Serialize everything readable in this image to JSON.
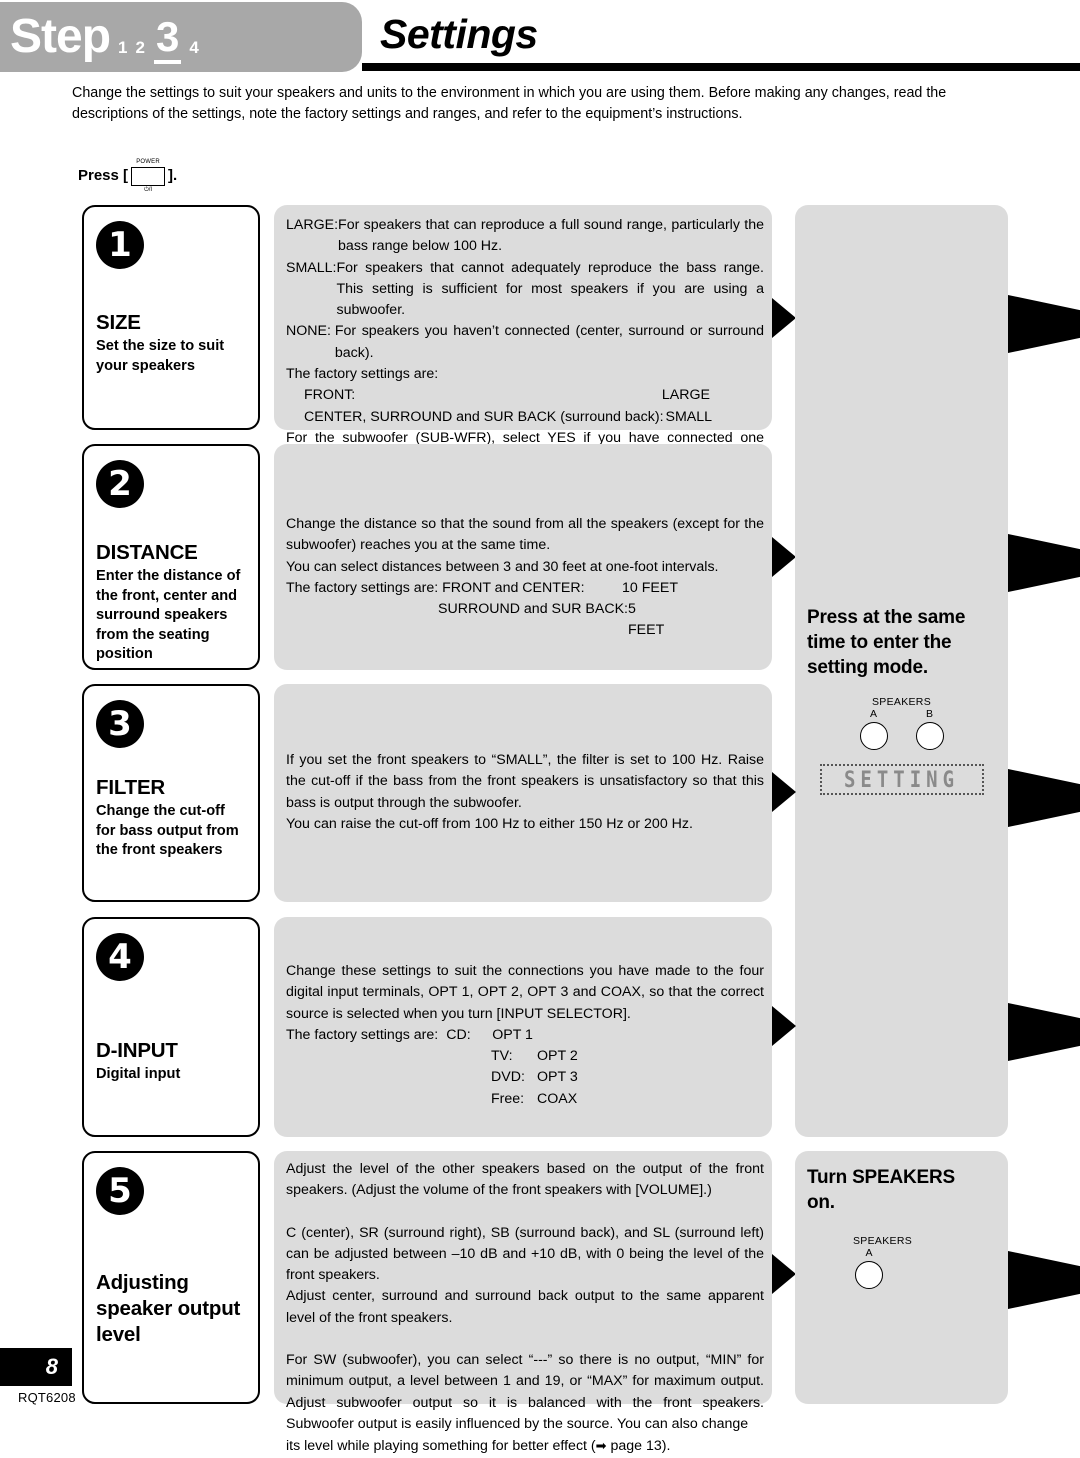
{
  "header": {
    "step_word": "Step",
    "steps": [
      "1",
      "2",
      "3",
      "4"
    ],
    "current_step": "3",
    "title": "Settings"
  },
  "intro": {
    "line1": "Change the settings to suit your speakers and units to the environment in which you are using them. Before making any changes, read the",
    "line2": "descriptions of the settings, note the factory settings and ranges, and refer to the equipment’s instructions."
  },
  "press_instruction": {
    "label": "Press [",
    "close": "].",
    "button_caption": "POWER",
    "button_symbol": "⏻/I"
  },
  "sections": [
    {
      "badge": "❶",
      "badge_num": "1",
      "title": "SIZE",
      "subtitle": "Set the size to suit\nyour speakers",
      "body": {
        "defs": [
          {
            "key": "LARGE:",
            "value": "For speakers that can reproduce a full sound range, particularly the bass range below 100 Hz."
          },
          {
            "key": "SMALL:",
            "value": "For speakers that cannot adequately reproduce the bass range. This setting is sufficient for most speakers if you are using a subwoofer."
          },
          {
            "key": "NONE: ",
            "value": "For speakers you haven’t connected (center, surround or surround back)."
          }
        ],
        "factory_label": "The factory settings are:",
        "factory_rows": [
          {
            "k": "FRONT:",
            "v": "LARGE"
          },
          {
            "k": "CENTER, SURROUND and SUR BACK (surround back):",
            "v": "SMALL"
          }
        ],
        "tail": "For the subwoofer (SUB-WFR), select YES if you have connected one (factory setting), or NO if you have not."
      }
    },
    {
      "badge": "❷",
      "badge_num": "2",
      "title": "DISTANCE",
      "subtitle": "Enter the distance of\nthe front, center and\nsurround speakers\nfrom the seating\nposition",
      "body": {
        "para1": "Change the distance so that the sound from all the speakers (except for the subwoofer) reaches you at the same time.",
        "para2": "You can select distances between 3 and 30 feet at one-foot intervals.",
        "factory_prefix": "The factory settings are: FRONT and CENTER:",
        "factory_value1": "10 FEET",
        "factory_row2_key": "SURROUND and SUR BACK:",
        "factory_row2_value": "5 FEET"
      }
    },
    {
      "badge": "❸",
      "badge_num": "3",
      "title": "FILTER",
      "subtitle": "Change the cut-off\nfor bass output from\nthe front speakers",
      "body": {
        "para1": "If you set the front speakers to “SMALL”, the filter is set to 100 Hz. Raise the cut-off if the bass from the front speakers is unsatisfactory so that this bass is output through the subwoofer.",
        "para2": "You can raise the cut-off from 100 Hz to either 150 Hz or 200 Hz."
      }
    },
    {
      "badge": "❹",
      "badge_num": "4",
      "title": "D-INPUT",
      "subtitle": "Digital input",
      "body": {
        "para1": "Change these settings to suit the connections you have made to the four digital input terminals, OPT 1, OPT 2, OPT 3 and COAX, so that the correct source is selected when you turn [INPUT SELECTOR].",
        "factory_prefix": "The factory settings are:",
        "factory_rows": [
          {
            "k": "CD:",
            "v": "OPT 1"
          },
          {
            "k": "TV:",
            "v": "OPT 2"
          },
          {
            "k": "DVD:",
            "v": "OPT 3"
          },
          {
            "k": "Free:",
            "v": "COAX"
          }
        ]
      }
    },
    {
      "badge": "❺",
      "badge_num": "5",
      "title": "Adjusting\nspeaker output\nlevel",
      "subtitle": "",
      "body": {
        "para1": "Adjust the level of the other speakers based on the output of the front speakers. (Adjust the volume of the front speakers with [VOLUME].)",
        "para2": "C (center), SR (surround right), SB (surround back), and SL (surround left) can be adjusted between –10 dB and +10 dB, with 0 being the level of the front speakers.",
        "para3": "Adjust center, surround and surround back output to the same apparent level of the front speakers.",
        "para4": "For SW (subwoofer), you can select “---” so there is no output, “MIN” for minimum output, a level between 1 and 19, or “MAX” for maximum output. Adjust subwoofer output so it is balanced with the front speakers. Subwoofer output is easily influenced by the source. You can also change",
        "para5_pre": "its level while playing something for better effect (",
        "para5_arrow": "➡",
        "para5_post": " page 13)."
      }
    }
  ],
  "right_top": {
    "heading": "Press at the same\ntime to enter the\nsetting mode.",
    "speakers_caption": "SPEAKERS",
    "knob_a": "A",
    "knob_b": "B",
    "display_text": "SETTING"
  },
  "right_bottom": {
    "heading": "Turn SPEAKERS\non.",
    "speakers_caption": "SPEAKERS",
    "knob_a": "A"
  },
  "footer": {
    "page_number": "8",
    "doc_code": "RQT6208"
  },
  "colors": {
    "banner_gray": "#a8a8a8",
    "panel_gray": "#dcdcdc",
    "black": "#000000",
    "display_gray": "#8a8a8a"
  }
}
